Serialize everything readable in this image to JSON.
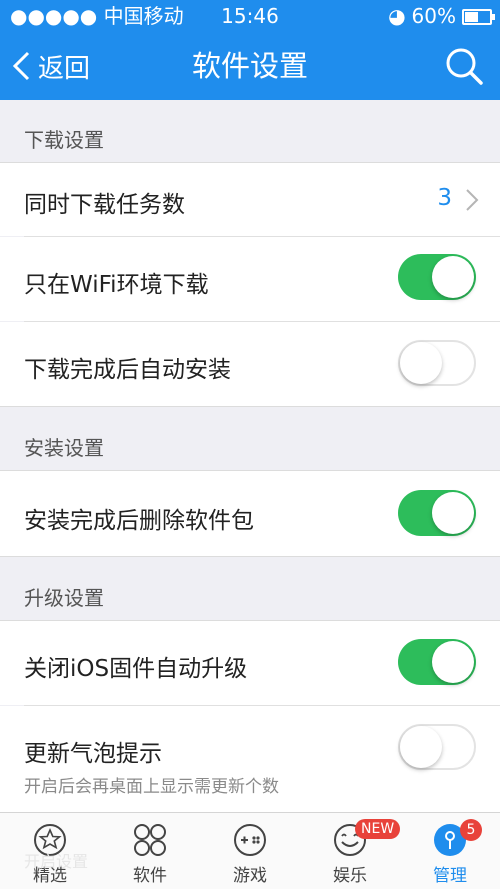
{
  "status": {
    "carrier": "中国移动",
    "time": "15:46",
    "battery": "60%",
    "battery_level": 0.6
  },
  "nav": {
    "back_label": "返回",
    "title": "软件设置"
  },
  "sections": [
    {
      "title": "下载设置"
    },
    {
      "title": "安装设置"
    },
    {
      "title": "升级设置"
    }
  ],
  "download": {
    "concurrent_label": "同时下载任务数",
    "concurrent_value": "3",
    "wifi_only_label": "只在WiFi环境下载",
    "wifi_only_on": true,
    "auto_install_label": "下载完成后自动安装",
    "auto_install_on": false
  },
  "install": {
    "delete_pkg_label": "安装完成后删除软件包",
    "delete_pkg_on": true
  },
  "upgrade": {
    "disable_ios_label": "关闭iOS固件自动升级",
    "disable_ios_on": true,
    "bubble_label": "更新气泡提示",
    "bubble_sub": "开启后会再桌面上显示需更新个数",
    "bubble_on": false
  },
  "ghost_text": "开启设置",
  "tabs": [
    {
      "label": "精选",
      "icon": "star-icon"
    },
    {
      "label": "软件",
      "icon": "grid-icon"
    },
    {
      "label": "游戏",
      "icon": "gamepad-icon",
      "badge": ""
    },
    {
      "label": "娱乐",
      "icon": "smile-icon",
      "badge": "NEW"
    },
    {
      "label": "管理",
      "icon": "manage-icon",
      "badge": "5",
      "active": true
    }
  ],
  "colors": {
    "accent": "#1f8ded",
    "toggle_on": "#2dbd5b",
    "badge": "#e8423a"
  }
}
